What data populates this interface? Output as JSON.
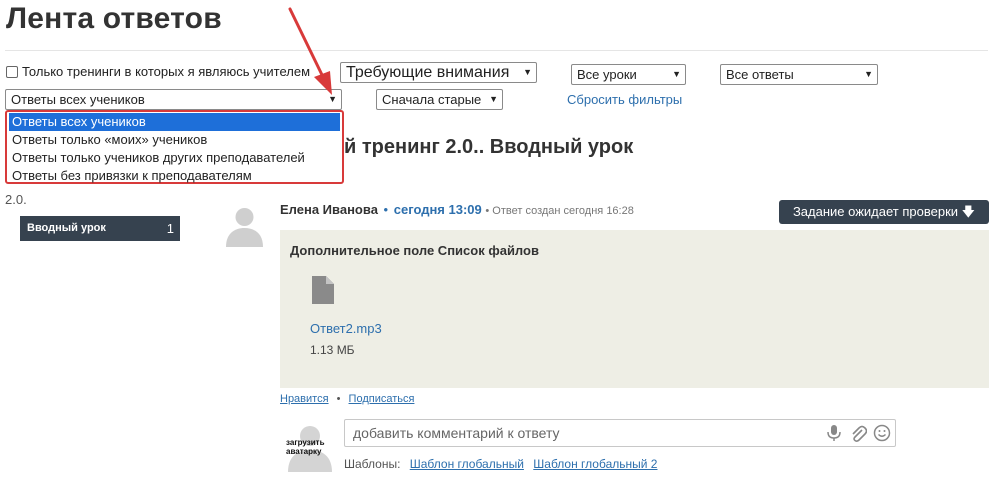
{
  "page": {
    "title": "Лента ответов"
  },
  "filters": {
    "only_my_trainings_label": "Только тренинги в которых я являюсь учителем",
    "attention_select": "Требующие внимания",
    "lessons_select": "Все уроки",
    "answers_select": "Все ответы",
    "students_select": "Ответы всех учеников",
    "sort_select": "Сначала старые",
    "reset_link": "Сбросить фильтры"
  },
  "students_dropdown": {
    "options": [
      "Ответы всех учеников",
      "Ответы только «моих» учеников",
      "Ответы только учеников других преподавателей",
      "Ответы без привязки к преподавателям"
    ],
    "selected_index": 0
  },
  "training": {
    "heading": "й тренинг 2.0.. Вводный урок",
    "side_version": "2.0."
  },
  "sidebar": {
    "lesson_label": "Вводный урок",
    "lesson_count": "1"
  },
  "answer": {
    "author": "Елена Иванова",
    "separator": "•",
    "time": "сегодня 13:09",
    "meta": "• Ответ создан сегодня 16:28",
    "status_button": "Задание ожидает проверки",
    "status_icon": "arrow-down-icon",
    "field_title": "Дополнительное поле Список файлов",
    "file_name": "Ответ2.mp3",
    "file_size": "1.13 МБ",
    "like_link": "Нравится",
    "bullet": "•",
    "subscribe_link": "Подписаться"
  },
  "comment": {
    "upload_avatar_label": "загрузить аватарку",
    "placeholder": "добавить комментарий к ответу",
    "templates_label": "Шаблоны:",
    "template_1": "Шаблон глобальный",
    "template_2": "Шаблон глобальный 2"
  },
  "colors": {
    "accent_link": "#2d6fad",
    "dark_box": "#36424f",
    "highlight_red": "#d83a3a",
    "selection_blue": "#1e6fd9",
    "answer_bg": "#eeeee5"
  }
}
